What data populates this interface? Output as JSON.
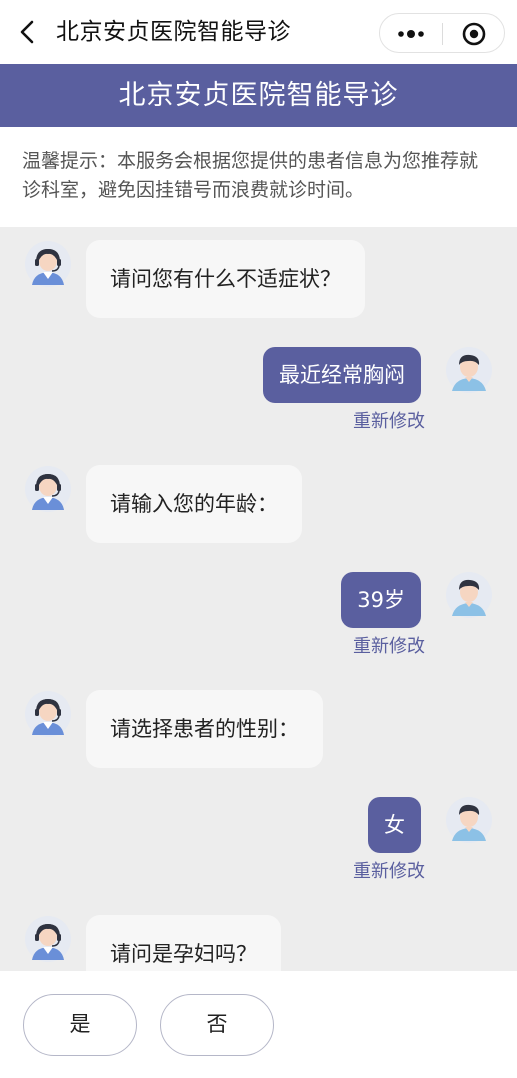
{
  "topbar": {
    "title": "北京安贞医院智能导诊",
    "back_icon": "chevron-left-icon",
    "more_icon": "more-dots-icon",
    "close_icon": "target-circle-icon"
  },
  "header": {
    "title": "北京安贞医院智能导诊"
  },
  "notice": {
    "text": "温馨提示：本服务会根据您提供的患者信息为您推荐就诊科室，避免因挂错号而浪费就诊时间。"
  },
  "chat": {
    "messages": [
      {
        "from": "bot",
        "text": "请问您有什么不适症状？"
      },
      {
        "from": "user",
        "text": "最近经常胸闷",
        "edit_label": "重新修改"
      },
      {
        "from": "bot",
        "text": "请输入您的年龄："
      },
      {
        "from": "user",
        "text": "39岁",
        "edit_label": "重新修改"
      },
      {
        "from": "bot",
        "text": "请选择患者的性别："
      },
      {
        "from": "user",
        "text": "女",
        "edit_label": "重新修改"
      },
      {
        "from": "bot",
        "text": "请问是孕妇吗？"
      }
    ]
  },
  "options": [
    {
      "label": "是"
    },
    {
      "label": "否"
    }
  ],
  "colors": {
    "accent": "#5a5f9f",
    "background": "#ededed",
    "bubble": "#f7f7f7"
  }
}
